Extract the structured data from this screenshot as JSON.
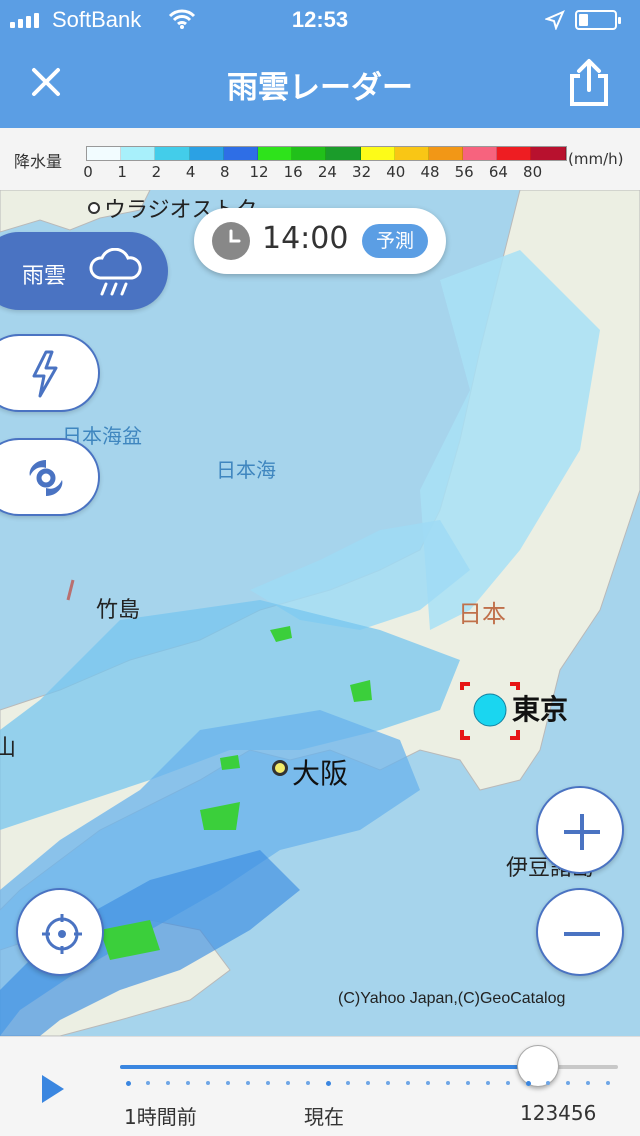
{
  "status_bar": {
    "carrier": "SoftBank",
    "time": "12:53",
    "battery_level": 0.25
  },
  "header": {
    "title": "雨雲レーダー",
    "close_icon": "close-icon",
    "share_icon": "share-icon"
  },
  "legend": {
    "label": "降水量",
    "ticks": [
      "0",
      "1",
      "2",
      "4",
      "8",
      "12",
      "16",
      "24",
      "32",
      "40",
      "48",
      "56",
      "64",
      "80"
    ],
    "unit": "(mm/h)",
    "colors": [
      "#f2fcff",
      "#a8f0fb",
      "#43cdea",
      "#2ba1e4",
      "#2e6ee6",
      "#2ee31b",
      "#21c01a",
      "#1b9c2b",
      "#fdfb18",
      "#f9c615",
      "#f29716",
      "#f7637e",
      "#ee1d22",
      "#b8112e"
    ]
  },
  "time_pill": {
    "time": "14:00",
    "badge": "予測"
  },
  "layers": {
    "rain_label": "雨雲"
  },
  "map": {
    "labels": {
      "vladivostok": "ウラジオストク",
      "japan_basin": "日本海盆",
      "sea_of_japan": "日本海",
      "takeshima": "竹島",
      "japan": "日本",
      "tokyo": "東京",
      "osaka": "大阪",
      "izu": "伊豆諸島",
      "left_edge": "山"
    },
    "copyright": "(C)Yahoo Japan,(C)GeoCatalog"
  },
  "timeline": {
    "left_label": "1時間前",
    "center_label": "現在",
    "right_label": "123456",
    "progress": 0.84
  }
}
